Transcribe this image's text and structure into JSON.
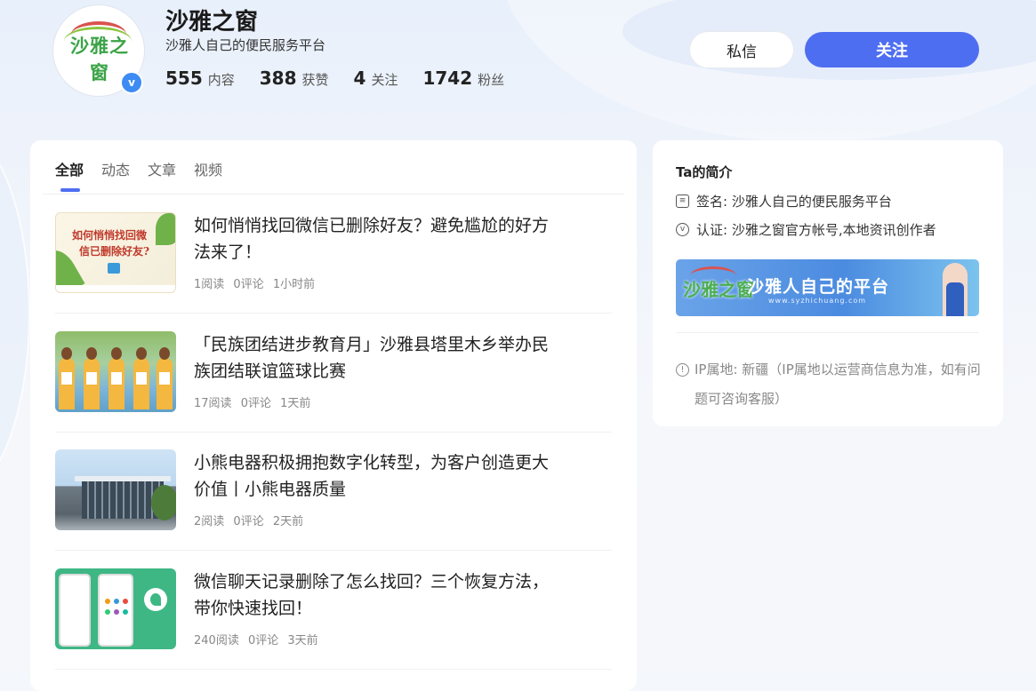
{
  "profile": {
    "name": "沙雅之窗",
    "description": "沙雅人自己的便民服务平台",
    "avatar_logo_text": "沙雅之窗",
    "verified_icon": "v",
    "stats": [
      {
        "value": "555",
        "label": "内容"
      },
      {
        "value": "388",
        "label": "获赞"
      },
      {
        "value": "4",
        "label": "关注"
      },
      {
        "value": "1742",
        "label": "粉丝"
      }
    ]
  },
  "actions": {
    "message_label": "私信",
    "follow_label": "关注"
  },
  "tabs": [
    {
      "label": "全部",
      "active": true
    },
    {
      "label": "动态",
      "active": false
    },
    {
      "label": "文章",
      "active": false
    },
    {
      "label": "视频",
      "active": false
    }
  ],
  "articles": [
    {
      "title": "如何悄悄找回微信已删除好友？避免尴尬的好方法来了！",
      "reads": "1阅读",
      "comments": "0评论",
      "time": "1小时前",
      "thumb_text_1": "如何悄悄找回微",
      "thumb_text_2": "信已删除好友?"
    },
    {
      "title": "「民族团结进步教育月」沙雅县塔里木乡举办民族团结联谊篮球比赛",
      "reads": "17阅读",
      "comments": "0评论",
      "time": "1天前"
    },
    {
      "title": "小熊电器积极拥抱数字化转型，为客户创造更大价值丨小熊电器质量",
      "reads": "2阅读",
      "comments": "0评论",
      "time": "2天前"
    },
    {
      "title": "微信聊天记录删除了怎么找回？三个恢复方法，带你快速找回！",
      "reads": "240阅读",
      "comments": "0评论",
      "time": "3天前"
    }
  ],
  "sidebar": {
    "title": "Ta的简介",
    "signature": "签名: 沙雅人自己的便民服务平台",
    "certification": "认证: 沙雅之窗官方帐号,本地资讯创作者",
    "banner": {
      "logo_text": "沙雅之窗",
      "title": "沙雅人自己的平台",
      "url": "www.syzhichuang.com"
    },
    "ip_info": "IP属地: 新疆（IP属地以运营商信息为准，如有问题可咨询客服）"
  },
  "colors": {
    "accent": "#4e6ef2",
    "verified": "#3d8bf3"
  }
}
